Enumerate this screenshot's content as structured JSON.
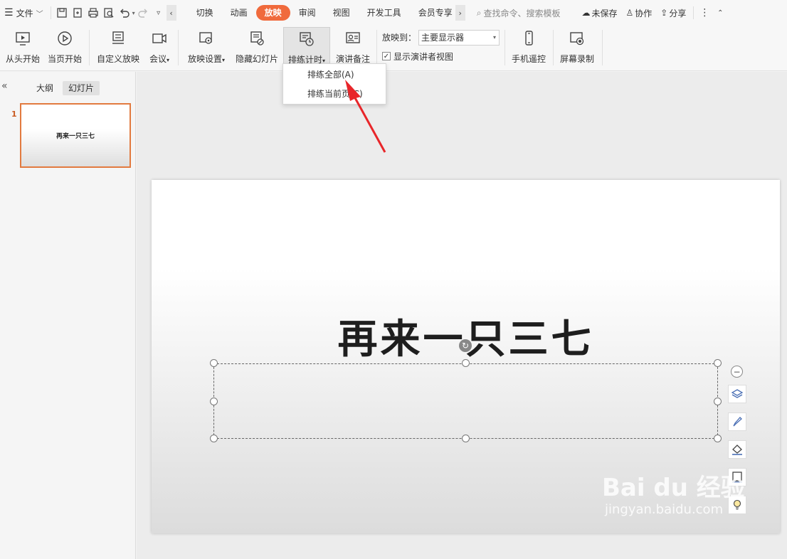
{
  "menubar": {
    "file_label": "文件",
    "tabs": [
      {
        "label": "切换"
      },
      {
        "label": "动画"
      },
      {
        "label": "放映"
      },
      {
        "label": "审阅"
      },
      {
        "label": "视图"
      },
      {
        "label": "开发工具"
      },
      {
        "label": "会员专享"
      }
    ],
    "search_placeholder": "查找命令、搜索模板",
    "unsaved_label": "未保存",
    "collab_label": "协作",
    "share_label": "分享"
  },
  "ribbon": {
    "from_start": "从头开始",
    "from_current": "当页开始",
    "custom_show": "自定义放映",
    "meeting": "会议",
    "show_settings": "放映设置",
    "hide_slide": "隐藏幻灯片",
    "rehearse": "排练计时",
    "speaker_notes": "演讲备注",
    "show_on_label": "放映到：",
    "show_on_value": "主要显示器",
    "presenter_view": "显示演讲者视图",
    "presenter_view_checked": true,
    "phone_remote": "手机遥控",
    "screen_record": "屏幕录制"
  },
  "dropdown": {
    "items": [
      {
        "label": "排练全部(A)"
      },
      {
        "label": "排练当前页(C)"
      }
    ]
  },
  "leftpanel": {
    "tab_outline": "大纲",
    "tab_slides": "幻灯片",
    "slide_number": "1",
    "thumb_title": "再来一只三七"
  },
  "slide": {
    "title": "再来一只三七"
  },
  "watermark": {
    "brand": "Bai du 经验",
    "url": "jingyan.baidu.com"
  },
  "colors": {
    "accent": "#f06a3c",
    "arrow": "#e8262a",
    "thumb_border": "#e27a3f"
  }
}
